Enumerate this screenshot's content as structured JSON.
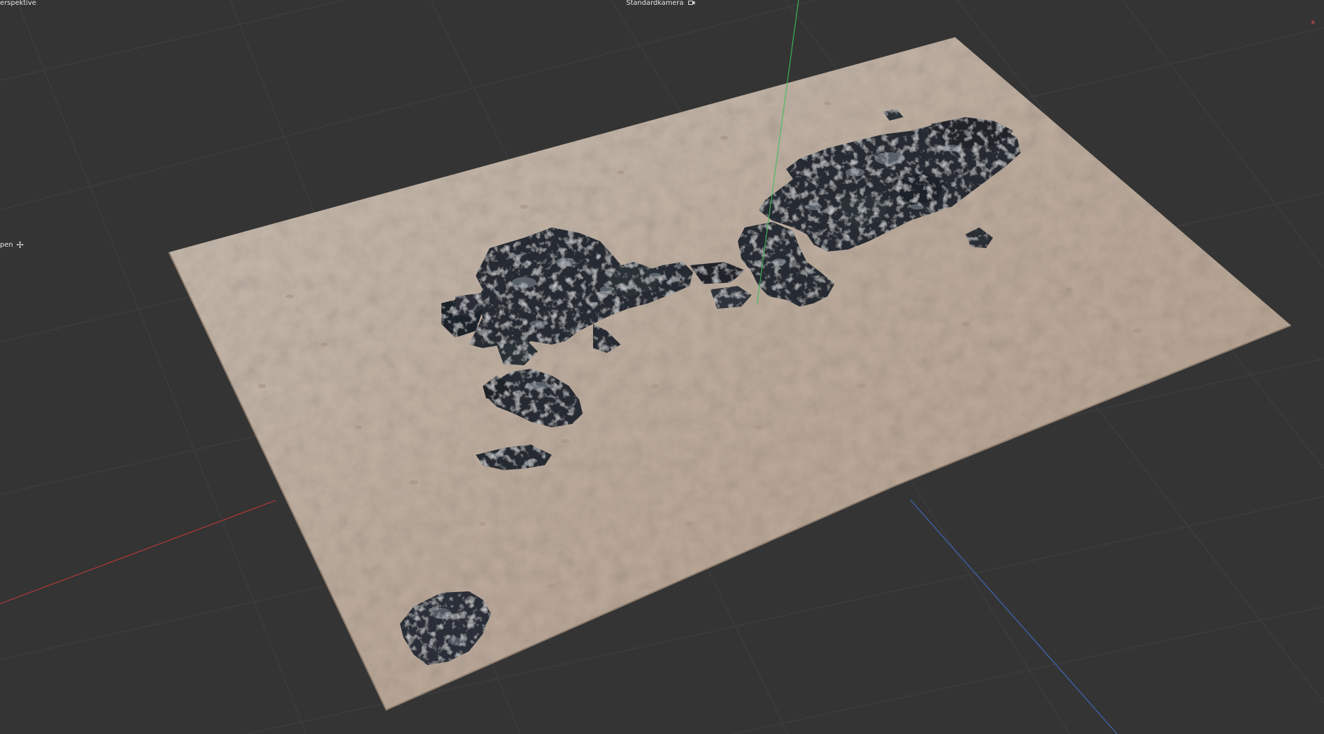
{
  "viewport": {
    "view_name": "erspektive",
    "camera_name": "Standardkamera",
    "side_label": "pen",
    "axis_x_label": "x"
  },
  "icons": {
    "camera": "camera-icon",
    "move": "move-icon"
  },
  "colors": {
    "background": "#343434",
    "grid": "#3e3e3e",
    "axis_x": "#c63a3a",
    "axis_y": "#3fbf5a",
    "axis_z": "#3f6fc6",
    "sand": "#bfae9f",
    "rock": "#23272e"
  }
}
